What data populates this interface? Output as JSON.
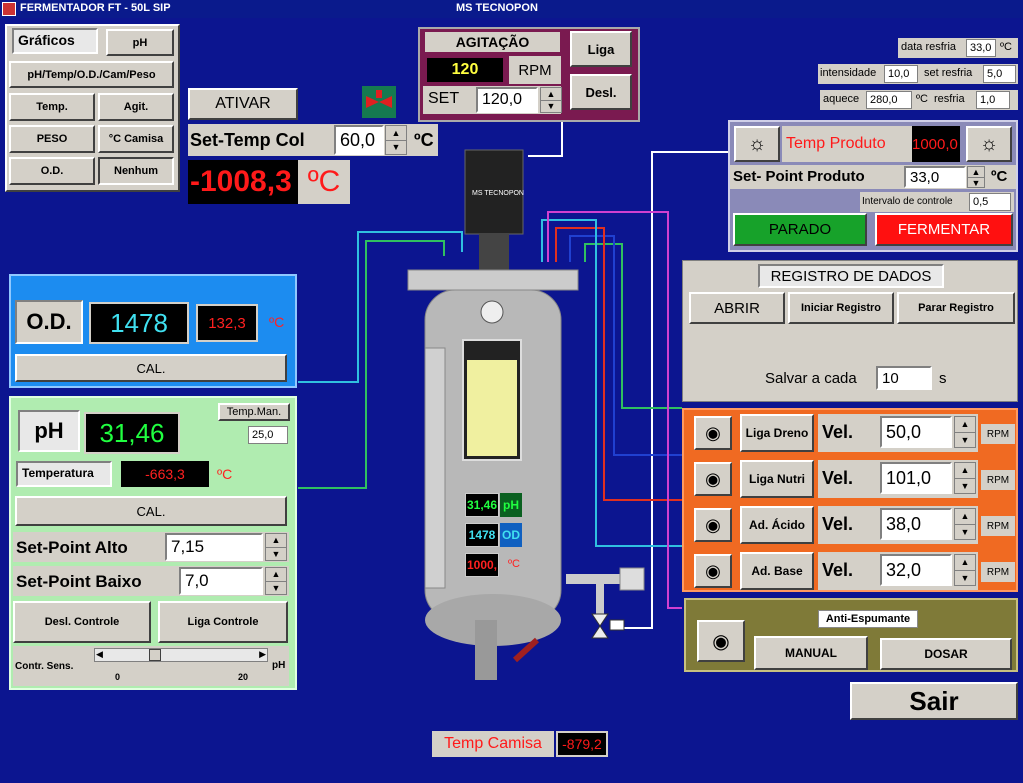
{
  "window": {
    "title_left": "FERMENTADOR FT - 50L     SIP",
    "title_center": "MS TECNOPON"
  },
  "graphs": {
    "title": "Gráficos",
    "ph": "pH",
    "combo": "pH/Temp/O.D./Cam/Peso",
    "temp": "Temp.",
    "agit": "Agit.",
    "peso": "PESO",
    "camisa": "°C Camisa",
    "od": "O.D.",
    "none": "Nenhum"
  },
  "col": {
    "activate": "ATIVAR",
    "set_label": "Set-Temp Col",
    "set_value": "60,0",
    "unit": "ºC",
    "reading": "-1008,3",
    "reading_unit": "ºC"
  },
  "agitation": {
    "title": "AGITAÇÃO",
    "rpm_value": "120",
    "rpm_label": "RPM",
    "set_label": "SET",
    "set_value": "120,0",
    "on": "Liga",
    "off": "Desl."
  },
  "cooling": {
    "data_label": "data resfria",
    "data_value": "33,0",
    "data_unit": "ºC",
    "intensity_label": "intensidade",
    "intensity_value": "10,0",
    "set_label": "set resfria",
    "set_value": "5,0",
    "heat_label": "aquece",
    "heat_value": "280,0",
    "heat_unit": "ºC",
    "cool_label": "resfria",
    "cool_value": "1,0"
  },
  "product": {
    "title": "Temp Produto",
    "value": "1000,0",
    "sp_label": "Set- Point Produto",
    "sp_value": "33,0",
    "sp_unit": "ºC",
    "interval_label": "Intervalo de controle",
    "interval_value": "0,5",
    "stopped": "PARADO",
    "ferment": "FERMENTAR"
  },
  "registry": {
    "title": "REGISTRO DE DADOS",
    "open": "ABRIR",
    "start": "Iniciar Registro",
    "stop": "Parar Registro",
    "save_label": "Salvar a cada",
    "save_value": "10",
    "save_unit": "s"
  },
  "od": {
    "label": "O.D.",
    "value": "1478",
    "temp": "132,3",
    "temp_unit": "ºC",
    "cal": "CAL."
  },
  "ph": {
    "label": "pH",
    "value": "31,46",
    "temp_man": "Temp.Man.",
    "temp_man_value": "25,0",
    "temp_label": "Temperatura",
    "temp_value": "-663,3",
    "temp_unit": "ºC",
    "cal": "CAL.",
    "sp_high_label": "Set-Point Alto",
    "sp_high_value": "7,15",
    "sp_low_label": "Set-Point Baixo",
    "sp_low_value": "7,0",
    "ctrl_off": "Desl. Controle",
    "ctrl_on": "Liga Controle",
    "sens_label": "Contr. Sens.",
    "slider_min": "0",
    "slider_max": "20",
    "slider_unit": "pH",
    "slider_value": 0.3
  },
  "vessel": {
    "brand": "MS TECNOPON",
    "ph_disp": "31,46",
    "ph_unit": "pH",
    "od_disp": "1478",
    "od_unit": "OD",
    "temp_disp": "1000,",
    "temp_unit": "ºC"
  },
  "pumps": [
    {
      "button": "Liga Dreno",
      "vel_label": "Vel.",
      "value": "50,0",
      "unit": "RPM"
    },
    {
      "button": "Liga Nutri",
      "vel_label": "Vel.",
      "value": "101,0",
      "unit": "RPM"
    },
    {
      "button": "Ad. Ácido",
      "vel_label": "Vel.",
      "value": "38,0",
      "unit": "RPM"
    },
    {
      "button": "Ad. Base",
      "vel_label": "Vel.",
      "value": "32,0",
      "unit": "RPM"
    }
  ],
  "antifoam": {
    "title": "Anti-Espumante",
    "manual": "MANUAL",
    "dose": "DOSAR"
  },
  "exit": "Sair",
  "jacket": {
    "label": "Temp Camisa",
    "value": "-879,2"
  }
}
